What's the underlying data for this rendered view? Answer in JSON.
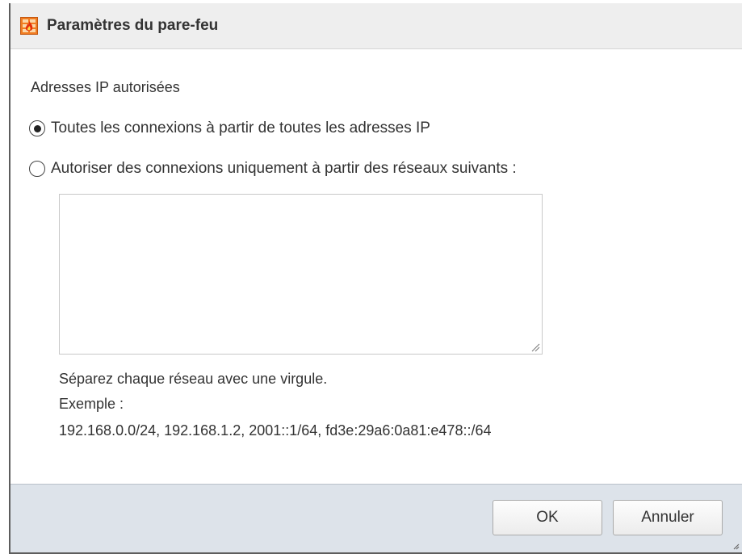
{
  "dialog": {
    "title": "Paramètres du pare-feu",
    "icon": "firewall-icon",
    "section_label": "Adresses IP autorisées",
    "options": [
      {
        "label": "Toutes les connexions à partir de toutes les adresses IP",
        "selected": true
      },
      {
        "label": "Autoriser des connexions uniquement à partir des réseaux suivants :",
        "selected": false
      }
    ],
    "networks_value": "",
    "help": {
      "line1": "Séparez chaque réseau avec une virgule.",
      "line2": "Exemple :",
      "line3": "192.168.0.0/24, 192.168.1.2, 2001::1/64, fd3e:29a6:0a81:e478::/64"
    },
    "buttons": {
      "ok": "OK",
      "cancel": "Annuler"
    }
  },
  "colors": {
    "titlebar": "#eeeeee",
    "footer": "#dde3ea",
    "border": "#5d5d5d",
    "icon_orange": "#f07c21"
  }
}
